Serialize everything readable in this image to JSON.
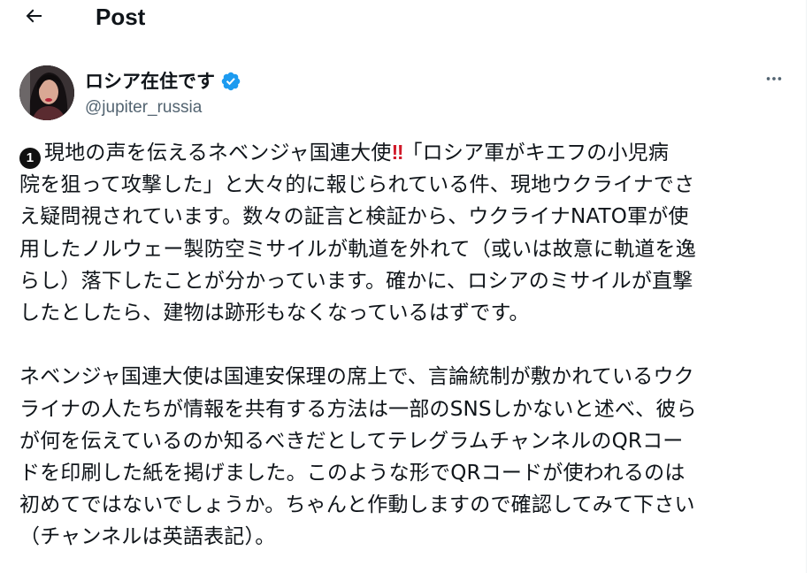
{
  "header": {
    "title": "Post"
  },
  "author": {
    "display_name": "ロシア在住です",
    "handle": "@jupiter_russia",
    "verified": true,
    "verified_color": "#1d9bf0"
  },
  "post": {
    "paragraph1": {
      "badge": "1",
      "line1_a": "現地の声を伝えるネベンジャ国連大使",
      "line1_bang": "‼",
      "line1_b": "「ロシア軍がキエフの小児病",
      "line2": "院を狙って攻撃した」と大々的に報じられている件、現地ウクライナでさ",
      "line3": "え疑問視されています。数々の証言と検証から、ウクライナNATO軍が使",
      "line4": "用したノルウェー製防空ミサイルが軌道を外れて（或いは故意に軌道を逸",
      "line5": "らし）落下したことが分かっています。確かに、ロシアのミサイルが直撃",
      "line6": "したとしたら、建物は跡形もなくなっているはずです。"
    },
    "paragraph2": {
      "line1": "ネベンジャ国連大使は国連安保理の席上で、言論統制が敷かれているウク",
      "line2": "ライナの人たちが情報を共有する方法は一部のSNSしかないと述べ、彼ら",
      "line3": "が何を伝えているのか知るべきだとしてテレグラムチャンネルのQRコー",
      "line4": "ドを印刷した紙を掲げました。このような形でQRコードが使われるのは",
      "line5": "初めてではないでしょうか。ちゃんと作動しますので確認してみて下さい",
      "line6": "（チャンネルは英語表記）。"
    }
  },
  "icons": {
    "back": "arrow-left-icon",
    "verified": "verified-badge-icon",
    "more": "more-horizontal-icon"
  }
}
